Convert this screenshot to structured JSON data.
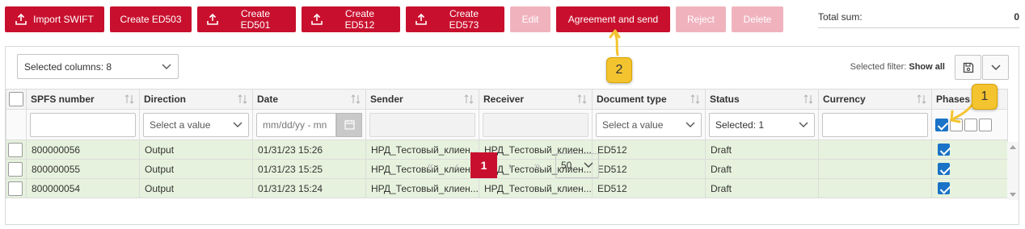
{
  "toolbar": {
    "buttons": [
      {
        "label": "Import SWIFT",
        "icon": "upload-icon",
        "state": "enabled"
      },
      {
        "label": "Create ED503",
        "state": "enabled"
      },
      {
        "label": "Create ED501",
        "icon": "upload-icon",
        "state": "enabled"
      },
      {
        "label": "Create ED512",
        "icon": "upload-icon",
        "state": "enabled"
      },
      {
        "label": "Create ED573",
        "icon": "upload-icon",
        "state": "enabled"
      },
      {
        "label": "Edit",
        "state": "disabled"
      },
      {
        "label": "Agreement and send",
        "state": "enabled"
      },
      {
        "label": "Reject",
        "state": "disabled"
      },
      {
        "label": "Delete",
        "state": "disabled"
      }
    ]
  },
  "total": {
    "label": "Total sum:",
    "value": "0"
  },
  "grid": {
    "columns_selector": "Selected columns: 8",
    "filter_label": "Selected filter:",
    "filter_value": "Show all",
    "headers": [
      "SPFS number",
      "Direction",
      "Date",
      "Sender",
      "Receiver",
      "Document type",
      "Status",
      "Currency",
      "Phases"
    ],
    "filters": {
      "direction_placeholder": "Select a value",
      "date_placeholder": "mm/dd/yy - mn",
      "doctype_placeholder": "Select a value",
      "status_value": "Selected: 1"
    },
    "rows": [
      {
        "spfs": "800000056",
        "direction": "Output",
        "date": "01/31/23 15:26",
        "sender": "НРД_Тестовый_клиен...",
        "receiver": "НРД_Тестовый_клиен...",
        "doctype": "ED512",
        "status": "Draft",
        "currency": ""
      },
      {
        "spfs": "800000055",
        "direction": "Output",
        "date": "01/31/23 15:25",
        "sender": "НРД_Тестовый_клиен...",
        "receiver": "НРД_Тестовый_клиен...",
        "doctype": "ED512",
        "status": "Draft",
        "currency": ""
      },
      {
        "spfs": "800000054",
        "direction": "Output",
        "date": "01/31/23 15:24",
        "sender": "НРД_Тестовый_клиен...",
        "receiver": "НРД_Тестовый_клиен...",
        "doctype": "ED512",
        "status": "Draft",
        "currency": ""
      }
    ]
  },
  "pager": {
    "first": "«",
    "prev": "‹",
    "current": "1",
    "next": "›",
    "last": "»",
    "page_size": "50"
  },
  "markers": {
    "one": "1",
    "two": "2"
  },
  "colors": {
    "primary": "#c8102e",
    "disabled": "#f0b3bd",
    "row_bg": "#e6f2dd",
    "marker": "#f4c430",
    "checkbox": "#1a73c7"
  }
}
